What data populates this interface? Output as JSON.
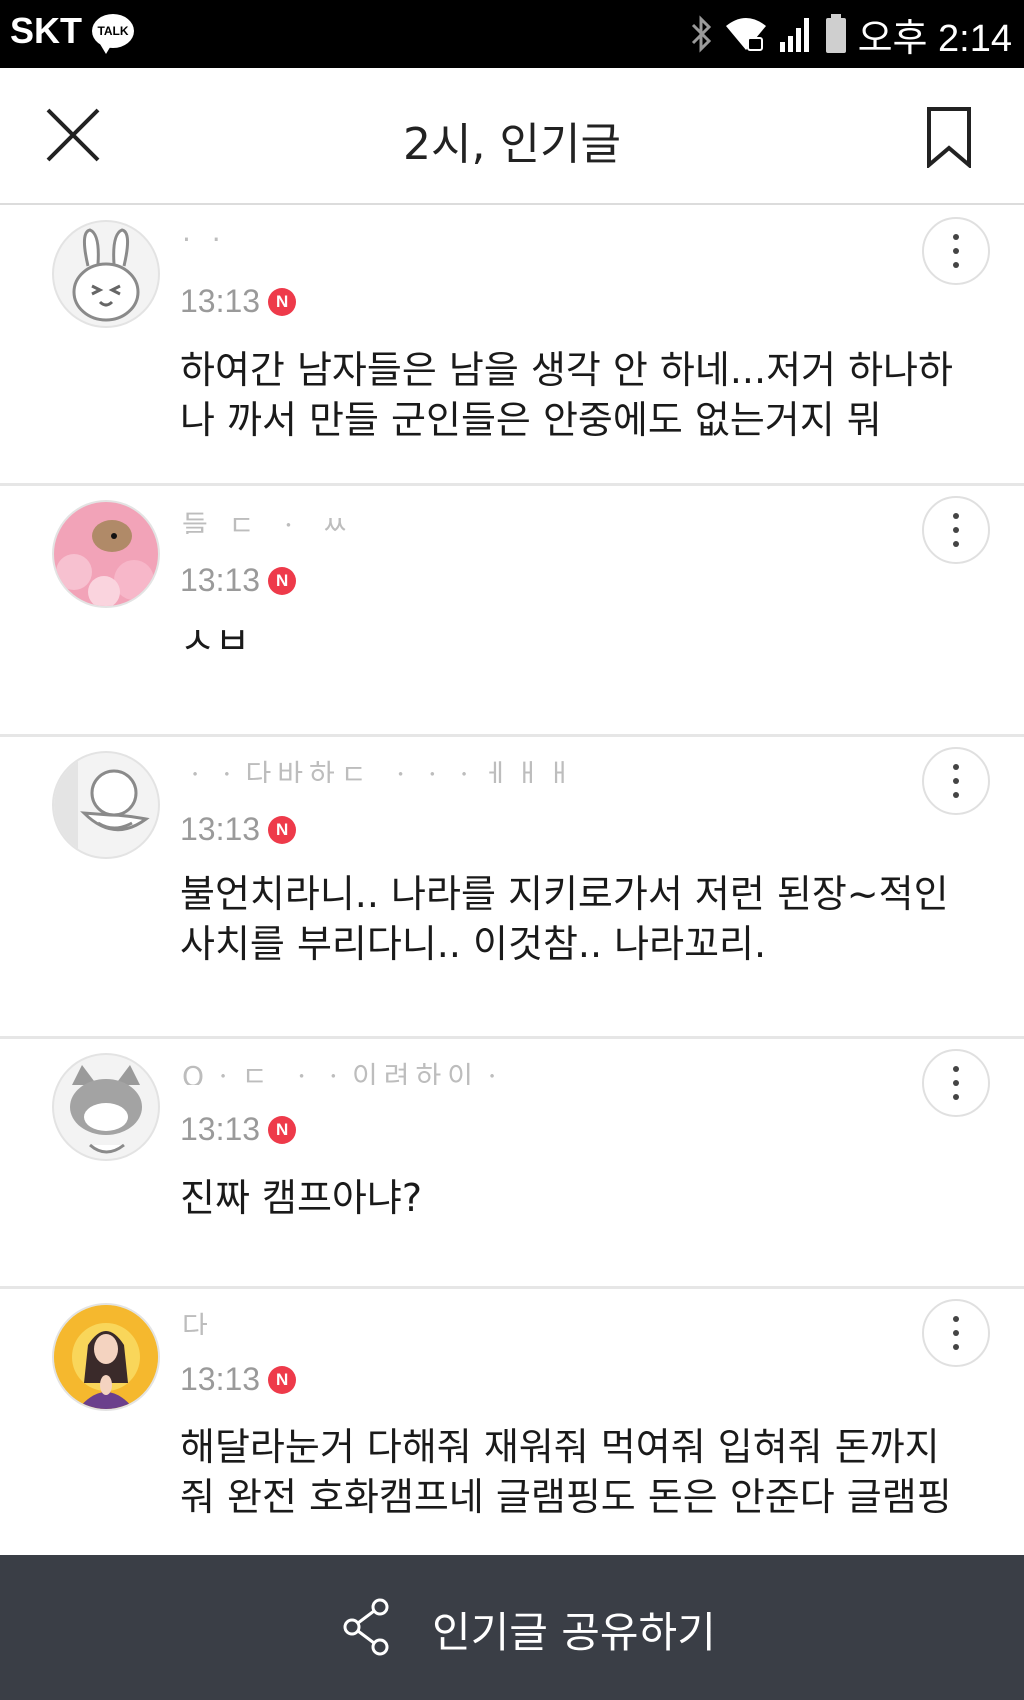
{
  "status_bar": {
    "carrier": "SKT",
    "talk_badge": "TALK",
    "time": "오후 2:14",
    "icons": [
      "bluetooth-icon",
      "wifi-icon",
      "signal-icon",
      "battery-icon"
    ]
  },
  "header": {
    "title": "2시, 인기글",
    "close_icon": "close-icon",
    "bookmark_icon": "bookmark-icon"
  },
  "comments": [
    {
      "author": "· ·",
      "time": "13:13",
      "badge": "N",
      "text": "하여간 남자들은 남을 생각 안 하네...저거 하나하나 까서 만들 군인들은 안중에도 없는거지 뭐",
      "avatar": "bunny-avatar"
    },
    {
      "author": "들 ㄷ ㆍ ㅆ",
      "time": "13:13",
      "badge": "N",
      "text": "ㅅㅂ",
      "avatar": "hamster-avatar"
    },
    {
      "author": "ㆍㆍ다바하ㄷ ㆍㆍㆍㅔㅐㅐ",
      "time": "13:13",
      "badge": "N",
      "text": "불언치라니.. 나라를 지키로가서 저런 된장~적인 사치를 부리다니.. 이것참.. 나라꼬리.",
      "avatar": "duck-avatar"
    },
    {
      "author": "Oㆍㄷ ㆍㆍ이려하이ㆍ",
      "time": "13:13",
      "badge": "N",
      "text": "진짜 캠프아냐?",
      "avatar": "cat-avatar"
    },
    {
      "author": "다",
      "time": "13:13",
      "badge": "N",
      "text": "해달라눈거 다해줘 재워줘 먹여줘 입혀줘 돈까지 줘 완전 호화캠프네 글램핑도 돈은 안준다 글램핑",
      "avatar": "girl-avatar"
    }
  ],
  "footer": {
    "share_label": "인기글 공유하기",
    "share_icon": "share-icon"
  },
  "colors": {
    "accent_badge": "#ee3a4a",
    "footer_bg": "#3a3e46"
  }
}
